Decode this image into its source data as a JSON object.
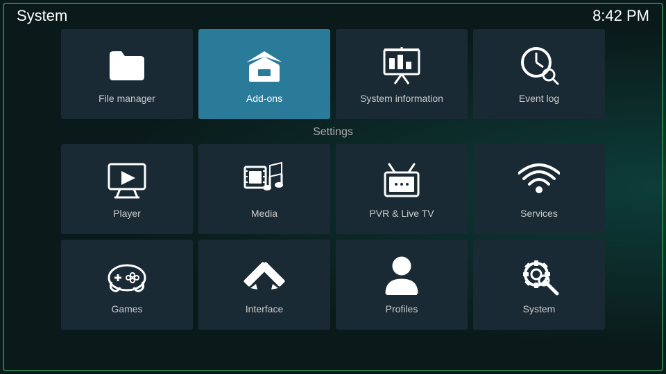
{
  "header": {
    "title": "System",
    "time": "8:42 PM"
  },
  "top_row": [
    {
      "id": "file-manager",
      "label": "File manager",
      "active": false
    },
    {
      "id": "add-ons",
      "label": "Add-ons",
      "active": true
    },
    {
      "id": "system-information",
      "label": "System information",
      "active": false
    },
    {
      "id": "event-log",
      "label": "Event log",
      "active": false
    }
  ],
  "settings_section": {
    "label": "Settings",
    "row1": [
      {
        "id": "player",
        "label": "Player"
      },
      {
        "id": "media",
        "label": "Media"
      },
      {
        "id": "pvr-live-tv",
        "label": "PVR & Live TV"
      },
      {
        "id": "services",
        "label": "Services"
      }
    ],
    "row2": [
      {
        "id": "games",
        "label": "Games"
      },
      {
        "id": "interface",
        "label": "Interface"
      },
      {
        "id": "profiles",
        "label": "Profiles"
      },
      {
        "id": "system",
        "label": "System"
      }
    ]
  }
}
